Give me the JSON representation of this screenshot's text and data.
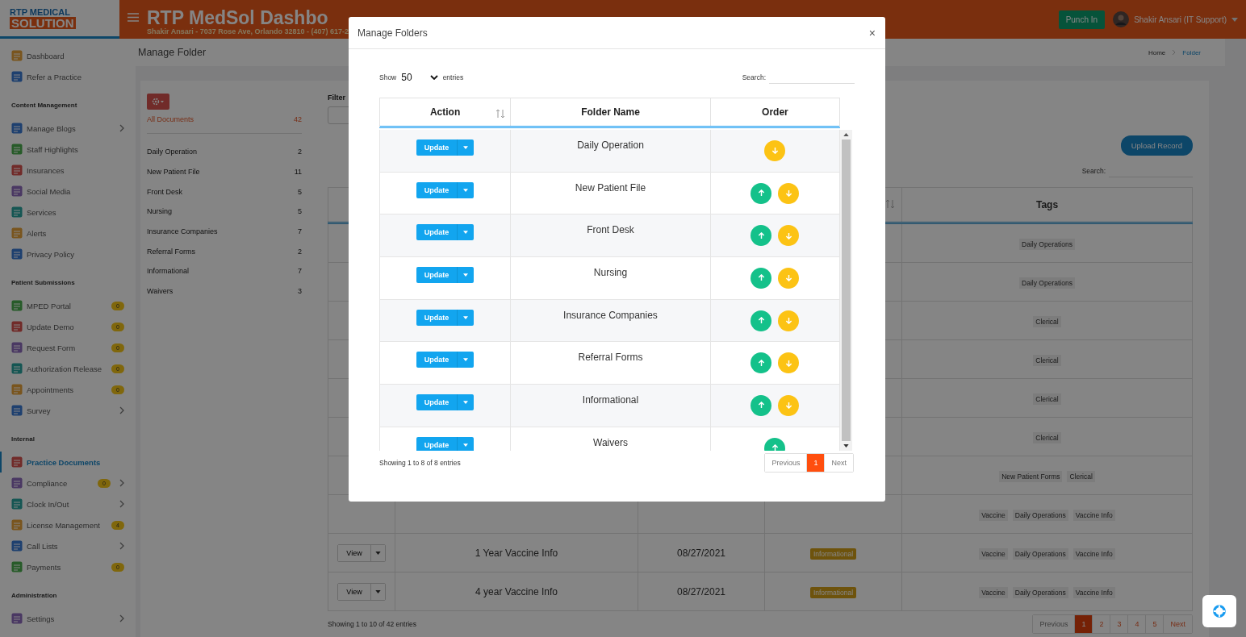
{
  "header": {
    "logo_top": "RTP MEDICAL",
    "logo_bottom": "SOLUTION",
    "title": "RTP MedSol Dashbo",
    "subtitle": "Shakir Ansari - 7037 Rose Ave, Orlando 32810 - (407) 617-2",
    "punch_button": "Punch In",
    "user": "Shakir Ansari (IT Support)"
  },
  "sidebar": {
    "sections": [
      {
        "items": [
          {
            "label": "Dashboard",
            "selected": false,
            "submenu": false
          },
          {
            "label": "Refer a Practice",
            "selected": false,
            "submenu": false
          }
        ]
      },
      {
        "heading": "Content Management",
        "items": [
          {
            "label": "Manage Blogs",
            "selected": false,
            "submenu": true
          },
          {
            "label": "Staff Highlights",
            "selected": false,
            "submenu": false
          },
          {
            "label": "Insurances",
            "selected": false,
            "submenu": false
          },
          {
            "label": "Social Media",
            "selected": false,
            "submenu": false
          },
          {
            "label": "Services",
            "selected": false,
            "submenu": false
          },
          {
            "label": "Alerts",
            "selected": false,
            "submenu": false
          },
          {
            "label": "Privacy Policy",
            "selected": false,
            "submenu": false
          }
        ]
      },
      {
        "heading": "Patient Submissions",
        "items": [
          {
            "label": "MPED Portal",
            "badge": "0",
            "selected": false,
            "submenu": false
          },
          {
            "label": "Update Demo",
            "badge": "0",
            "selected": false,
            "submenu": false
          },
          {
            "label": "Request Form",
            "badge": "0",
            "selected": false,
            "submenu": false
          },
          {
            "label": "Authorization Release",
            "badge": "0",
            "selected": false,
            "submenu": false
          },
          {
            "label": "Appointments",
            "badge": "0",
            "selected": false,
            "submenu": false
          },
          {
            "label": "Survey",
            "selected": false,
            "submenu": true
          }
        ]
      },
      {
        "heading": "Internal",
        "items": [
          {
            "label": "Practice Documents",
            "selected": true,
            "submenu": false
          },
          {
            "label": "Compliance",
            "badge": "0",
            "selected": false,
            "submenu": true
          },
          {
            "label": "Clock In/Out",
            "selected": false,
            "submenu": true
          },
          {
            "label": "License Management",
            "badge": "4",
            "selected": false,
            "submenu": false
          },
          {
            "label": "Call Lists",
            "selected": false,
            "submenu": true
          },
          {
            "label": "Payments",
            "badge": "0",
            "selected": false,
            "submenu": false
          }
        ]
      },
      {
        "heading": "Administration",
        "items": [
          {
            "label": "Settings",
            "selected": false,
            "submenu": true
          }
        ]
      }
    ]
  },
  "page": {
    "title": "Manage Folder",
    "breadcrumb": [
      {
        "label": "Home",
        "selected": false
      },
      {
        "label": "Folder",
        "selected": true
      }
    ]
  },
  "folders": {
    "all": {
      "label": "All Documents",
      "count": "42"
    },
    "items": [
      {
        "label": "Daily Operation",
        "count": "2"
      },
      {
        "label": "New Patient File",
        "count": "11"
      },
      {
        "label": "Front Desk",
        "count": "5"
      },
      {
        "label": "Nursing",
        "count": "5"
      },
      {
        "label": "Insurance Companies",
        "count": "7"
      },
      {
        "label": "Referral Forms",
        "count": "2"
      },
      {
        "label": "Informational",
        "count": "7"
      },
      {
        "label": "Waivers",
        "count": "3"
      }
    ]
  },
  "filter_label": "Filter",
  "upload_button": "Upload Record",
  "search_label": "Search:",
  "table": {
    "tags_heading": "Tags",
    "rows": [
      {
        "tags": [
          "Daily Operations"
        ]
      },
      {
        "tags": [
          "Daily Operations"
        ]
      },
      {
        "tags": [
          "Clerical"
        ]
      },
      {
        "tags": [
          "Clerical"
        ]
      },
      {
        "tags": [
          "Clerical"
        ]
      },
      {
        "tags": [
          "Clerical"
        ]
      },
      {
        "tags": [
          "New Patient Forms",
          "Clerical"
        ]
      },
      {
        "tags": [
          "Vaccine",
          "Daily Operations",
          "Vaccine Info"
        ]
      },
      {
        "view": "View",
        "name": "1 Year Vaccine Info",
        "date": "08/27/2021",
        "category": "Informational",
        "tags": [
          "Vaccine",
          "Daily Operations",
          "Vaccine Info"
        ]
      },
      {
        "view": "View",
        "name": "4 year Vaccine Info",
        "date": "08/27/2021",
        "category": "Informational",
        "tags": [
          "Vaccine",
          "Daily Operations",
          "Vaccine Info"
        ]
      }
    ]
  },
  "table_info": "Showing 1 to 10 of 42 entries",
  "pagination": [
    {
      "label": "Previous",
      "selected": false
    },
    {
      "label": "1",
      "selected": true
    },
    {
      "label": "2",
      "selected": false
    },
    {
      "label": "3",
      "selected": false
    },
    {
      "label": "4",
      "selected": false
    },
    {
      "label": "5",
      "selected": false
    },
    {
      "label": "Next",
      "selected": false
    }
  ],
  "modal": {
    "title": "Manage Folders",
    "close": "×",
    "show_label": "Show",
    "page_size": "50",
    "entries_label": "entries",
    "search_label": "Search:",
    "columns": [
      "Action",
      "Folder Name",
      "Order"
    ],
    "rows": [
      {
        "button": "Update",
        "name": "Daily Operation",
        "up": false,
        "down": true
      },
      {
        "button": "Update",
        "name": "New Patient File",
        "up": true,
        "down": true
      },
      {
        "button": "Update",
        "name": "Front Desk",
        "up": true,
        "down": true
      },
      {
        "button": "Update",
        "name": "Nursing",
        "up": true,
        "down": true
      },
      {
        "button": "Update",
        "name": "Insurance Companies",
        "up": true,
        "down": true
      },
      {
        "button": "Update",
        "name": "Referral Forms",
        "up": true,
        "down": true
      },
      {
        "button": "Update",
        "name": "Informational",
        "up": true,
        "down": true
      },
      {
        "button": "Update",
        "name": "Waivers",
        "up": true,
        "down": false
      }
    ],
    "info": "Showing 1 to 8 of 8 entries",
    "pagination": [
      {
        "label": "Previous",
        "selected": false
      },
      {
        "label": "1",
        "selected": true
      },
      {
        "label": "Next",
        "selected": false
      }
    ]
  }
}
